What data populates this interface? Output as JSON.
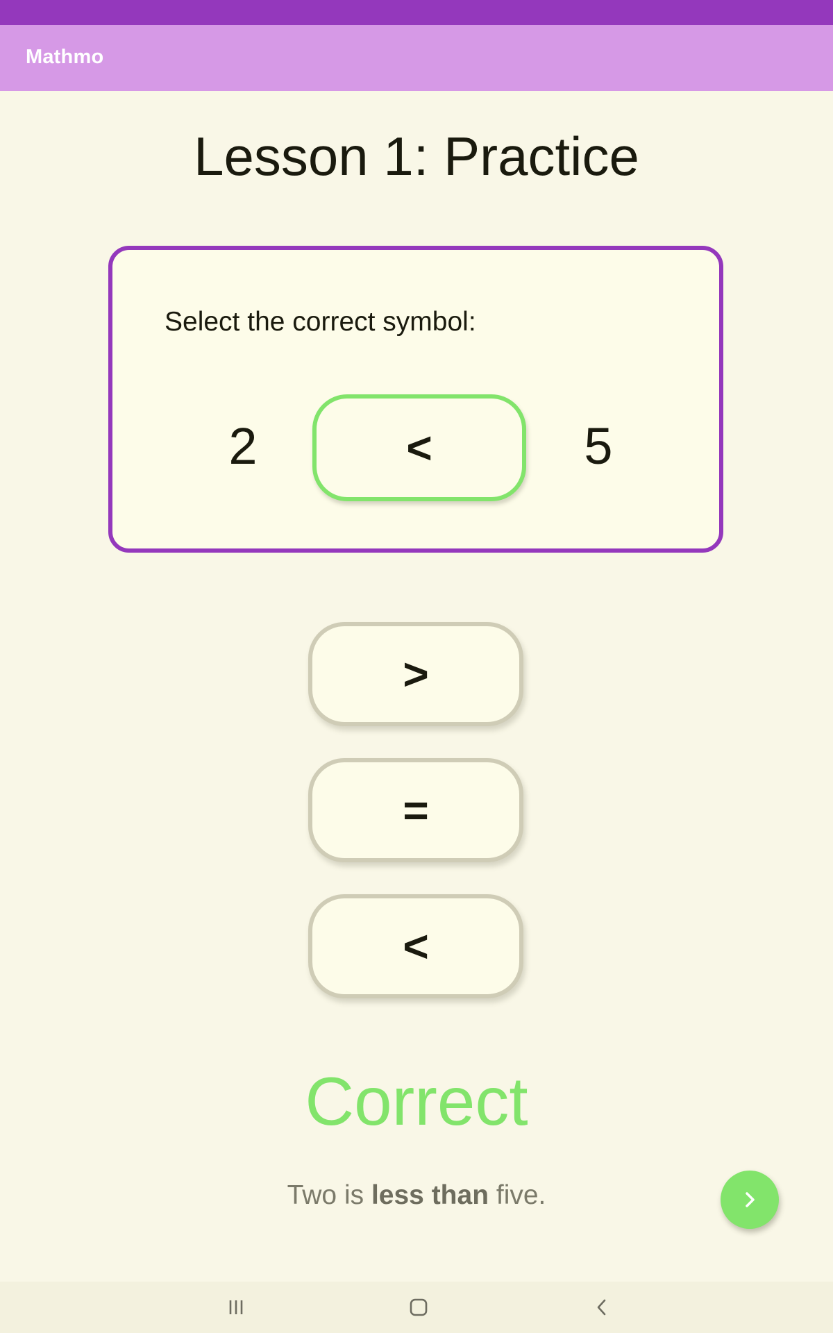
{
  "app_bar": {
    "title": "Mathmo"
  },
  "lesson": {
    "title": "Lesson 1: Practice"
  },
  "question": {
    "prompt": "Select the correct symbol:",
    "left_operand": "2",
    "selected_symbol": "<",
    "right_operand": "5"
  },
  "choices": [
    {
      "label": ">"
    },
    {
      "label": "="
    },
    {
      "label": "<"
    }
  ],
  "feedback": {
    "result": "Correct",
    "explanation_prefix": "Two is ",
    "explanation_emphasis": "less than",
    "explanation_suffix": " five."
  },
  "icons": {
    "next": "chevron-right-icon",
    "nav_recent": "recent-apps-icon",
    "nav_home": "home-icon",
    "nav_back": "back-icon"
  },
  "colors": {
    "primary": "#9438bc",
    "app_bar": "#d699e6",
    "correct": "#82e46b",
    "background": "#f9f7e7"
  }
}
